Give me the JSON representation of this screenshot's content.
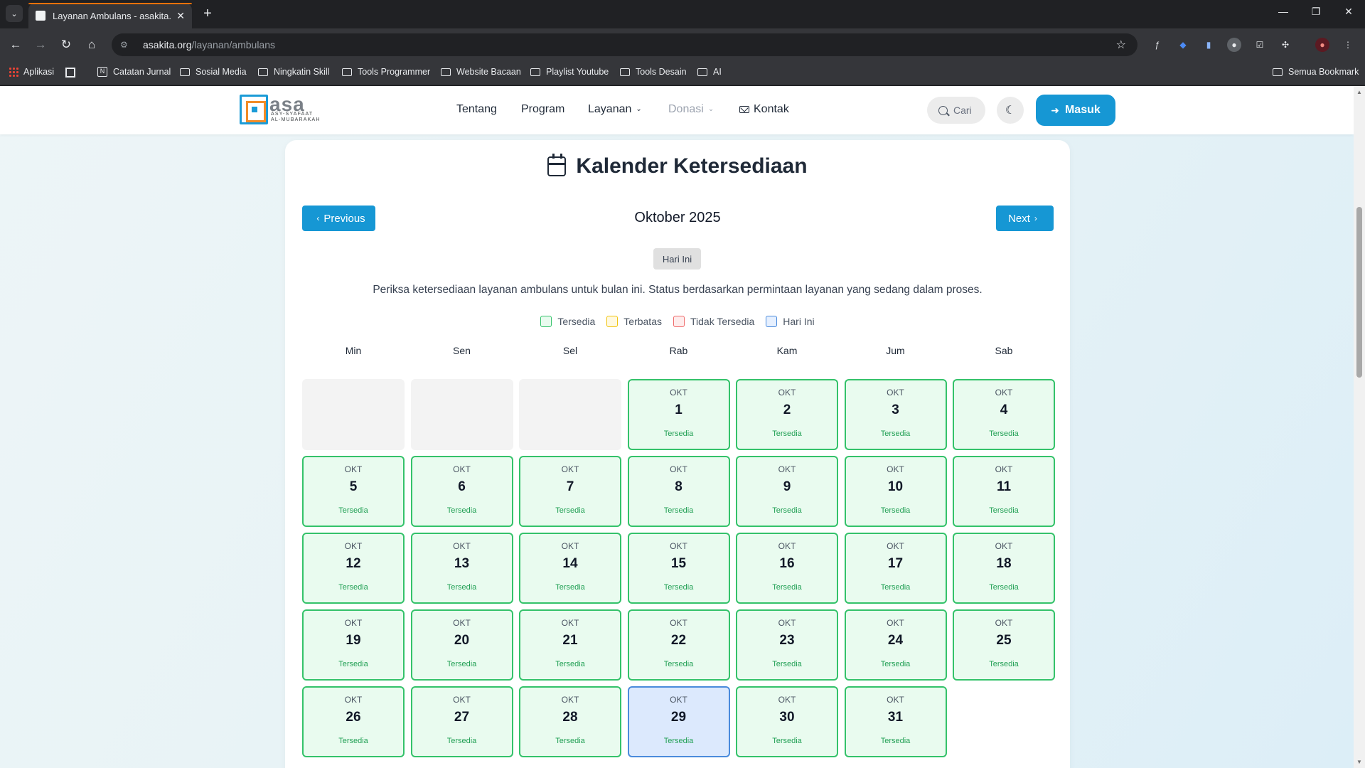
{
  "browser": {
    "tab_title": "Layanan Ambulans - asakita.org",
    "url_host": "asakita.org",
    "url_path": "/layanan/ambulans",
    "bookmarks": [
      "Aplikasi",
      "Catatan Jurnal",
      "Sosial Media",
      "Ningkatin Skill",
      "Tools Programmer",
      "Website Bacaan",
      "Playlist Youtube",
      "Tools Desain",
      "AI"
    ],
    "all_bookmarks": "Semua Bookmark"
  },
  "site": {
    "logo_word": "asa",
    "logo_line1": "ASY-SYAFAAT",
    "logo_line2": "AL-MUBARAKAH",
    "nav": {
      "about": "Tentang",
      "program": "Program",
      "services": "Layanan",
      "donation": "Donasi",
      "contact": "Kontak"
    },
    "search_label": "Cari",
    "login_label": "Masuk"
  },
  "calendar": {
    "title": "Kalender Ketersediaan",
    "prev_label": "Previous",
    "next_label": "Next",
    "month_label": "Oktober 2025",
    "today_label": "Hari Ini",
    "description": "Periksa ketersediaan layanan ambulans untuk bulan ini. Status berdasarkan permintaan layanan yang sedang dalam proses.",
    "legend": {
      "available": "Tersedia",
      "limited": "Terbatas",
      "unavailable": "Tidak Tersedia",
      "today": "Hari Ini"
    },
    "weekdays": [
      "Min",
      "Sen",
      "Sel",
      "Rab",
      "Kam",
      "Jum",
      "Sab"
    ],
    "leading_empty": 3,
    "month_abbr": "OKT",
    "today": 29,
    "days": [
      {
        "day": 1,
        "status": "Tersedia"
      },
      {
        "day": 2,
        "status": "Tersedia"
      },
      {
        "day": 3,
        "status": "Tersedia"
      },
      {
        "day": 4,
        "status": "Tersedia"
      },
      {
        "day": 5,
        "status": "Tersedia"
      },
      {
        "day": 6,
        "status": "Tersedia"
      },
      {
        "day": 7,
        "status": "Tersedia"
      },
      {
        "day": 8,
        "status": "Tersedia"
      },
      {
        "day": 9,
        "status": "Tersedia"
      },
      {
        "day": 10,
        "status": "Tersedia"
      },
      {
        "day": 11,
        "status": "Tersedia"
      },
      {
        "day": 12,
        "status": "Tersedia"
      },
      {
        "day": 13,
        "status": "Tersedia"
      },
      {
        "day": 14,
        "status": "Tersedia"
      },
      {
        "day": 15,
        "status": "Tersedia"
      },
      {
        "day": 16,
        "status": "Tersedia"
      },
      {
        "day": 17,
        "status": "Tersedia"
      },
      {
        "day": 18,
        "status": "Tersedia"
      },
      {
        "day": 19,
        "status": "Tersedia"
      },
      {
        "day": 20,
        "status": "Tersedia"
      },
      {
        "day": 21,
        "status": "Tersedia"
      },
      {
        "day": 22,
        "status": "Tersedia"
      },
      {
        "day": 23,
        "status": "Tersedia"
      },
      {
        "day": 24,
        "status": "Tersedia"
      },
      {
        "day": 25,
        "status": "Tersedia"
      },
      {
        "day": 26,
        "status": "Tersedia"
      },
      {
        "day": 27,
        "status": "Tersedia"
      },
      {
        "day": 28,
        "status": "Tersedia"
      },
      {
        "day": 29,
        "status": "Tersedia"
      },
      {
        "day": 30,
        "status": "Tersedia"
      },
      {
        "day": 31,
        "status": "Tersedia"
      }
    ]
  },
  "colors": {
    "accent": "#1697d4",
    "available_border": "#34c26a",
    "today_border": "#4a8bdc"
  }
}
